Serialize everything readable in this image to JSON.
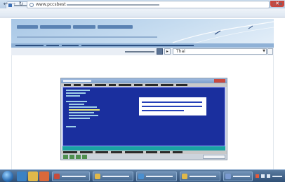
{
  "browser": {
    "tab": {
      "title": "",
      "favicon": "site-favicon"
    },
    "address_bar": {
      "url_visible": "www.pccsbest",
      "url_rest": ""
    }
  },
  "site": {
    "banner_title": "",
    "banner_subtitle": "",
    "nav_links": [
      "",
      "",
      "",
      ""
    ],
    "controls": {
      "label": "",
      "language_value": "Thai"
    }
  },
  "embedded_screenshot": {
    "window_title": "",
    "menu": [
      "",
      "",
      "",
      "",
      "",
      "",
      "",
      "",
      "",
      ""
    ],
    "code_lines": [
      "",
      "",
      "",
      "",
      "",
      "",
      "",
      "",
      "",
      "",
      ""
    ],
    "popup_text": [
      "",
      "",
      ""
    ],
    "help_line": "",
    "colors": {
      "editor_bg": "#1a2f9e",
      "editor_text": "#9fd0e8",
      "popup_border": "#1a2f9e",
      "status_bar": "#19a3a3"
    }
  },
  "taskbar": {
    "buttons": [
      {
        "label": "",
        "icon": "window-app-icon"
      },
      {
        "label": "",
        "icon": "browser-app-icon"
      },
      {
        "label": "",
        "icon": "explorer-app-icon"
      },
      {
        "label": "",
        "icon": "folder-app-icon"
      },
      {
        "label": "",
        "icon": "app-icon"
      }
    ],
    "tray_time": ""
  },
  "colors": {
    "banner": "#a8c7e6",
    "link_bar": "#8fb1d6",
    "taskbar": "#2f4f75"
  }
}
